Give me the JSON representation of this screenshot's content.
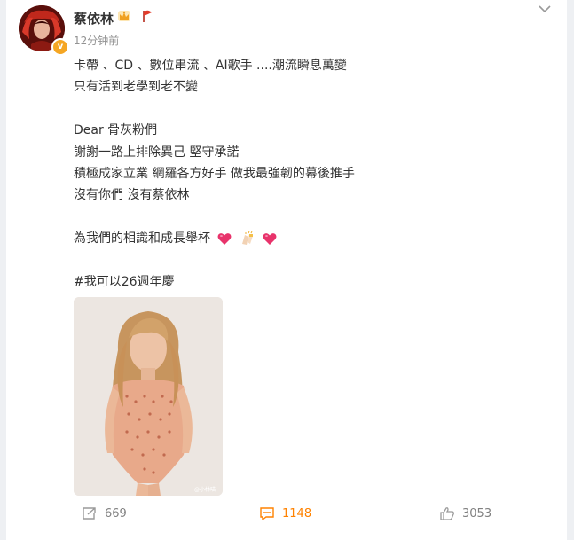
{
  "post": {
    "author": "蔡依林",
    "time": "12分钟前",
    "verified_badge": "v",
    "lines": [
      "卡帶 、CD 、數位串流 、AI歌手 ....潮流瞬息萬變",
      "只有活到老學到老不變",
      "",
      "Dear 骨灰粉們",
      "謝謝一路上排除異己 堅守承諾",
      "積極成家立業 網羅各方好手 做我最強韌的幕後推手",
      "沒有你們 沒有蔡依林",
      "",
      "為我們的相識和成長舉杯",
      "",
      "#我可以26週年慶"
    ],
    "toast_emojis": [
      "heart-icon",
      "cheers-icon",
      "heart-icon"
    ],
    "image": {
      "description_icon": "photo-woman-in-lace-bodysuit",
      "watermark": "@小林喵"
    }
  },
  "actions": {
    "repost_count": "669",
    "comment_count": "1148",
    "like_count": "3053"
  },
  "colors": {
    "accent": "#ff8200",
    "text": "#333333",
    "muted": "#939393",
    "heart": "#e8336b",
    "background": "#eef0f3"
  }
}
